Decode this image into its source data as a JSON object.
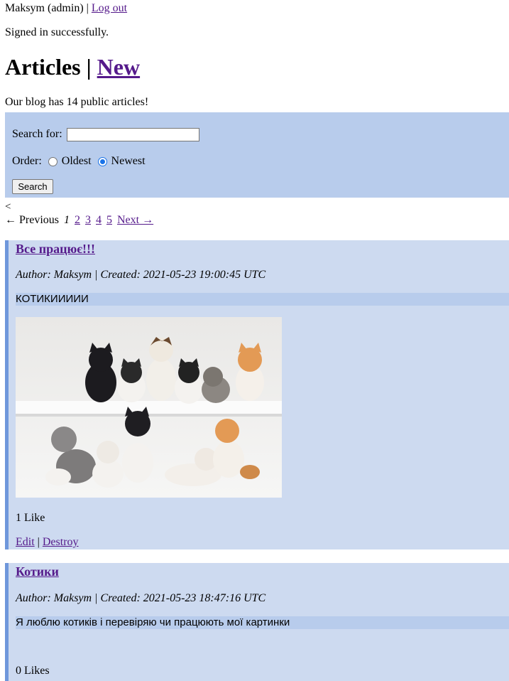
{
  "session": {
    "user_label": "Maksym (admin)",
    "separator": "|",
    "logout_label": "Log out"
  },
  "flash": {
    "notice": "Signed in successfully."
  },
  "header": {
    "title": "Articles",
    "separator": "|",
    "new_label": "New"
  },
  "summary": "Our blog has 14 public articles!",
  "search": {
    "label": "Search for:",
    "value": "",
    "order_label": "Order:",
    "options": [
      {
        "label": "Oldest",
        "checked": false
      },
      {
        "label": "Newest",
        "checked": true
      }
    ],
    "button_label": "Search"
  },
  "stray_text": "<",
  "pagination": {
    "previous": "← Previous",
    "current": "1",
    "pages": [
      "2",
      "3",
      "4",
      "5"
    ],
    "next": "Next →"
  },
  "articles": [
    {
      "title": "Все працює!!!",
      "meta": "Author: Maksym | Created: 2021-05-23 19:00:45 UTC",
      "body": "КОТИКИИИИИ",
      "image": "kittens-photo",
      "likes": "1 Like",
      "edit_label": "Edit",
      "separator": "|",
      "destroy_label": "Destroy"
    },
    {
      "title": "Котики",
      "meta": "Author: Maksym | Created: 2021-05-23 18:47:16 UTC",
      "body": "Я люблю котиків і перевіряю чи працюють мої картинки",
      "likes": "0 Likes"
    }
  ],
  "colors": {
    "panel": "#b8ccec",
    "article_bg": "#cddaf0",
    "article_border": "#6f97db",
    "link": "#551a8b"
  }
}
